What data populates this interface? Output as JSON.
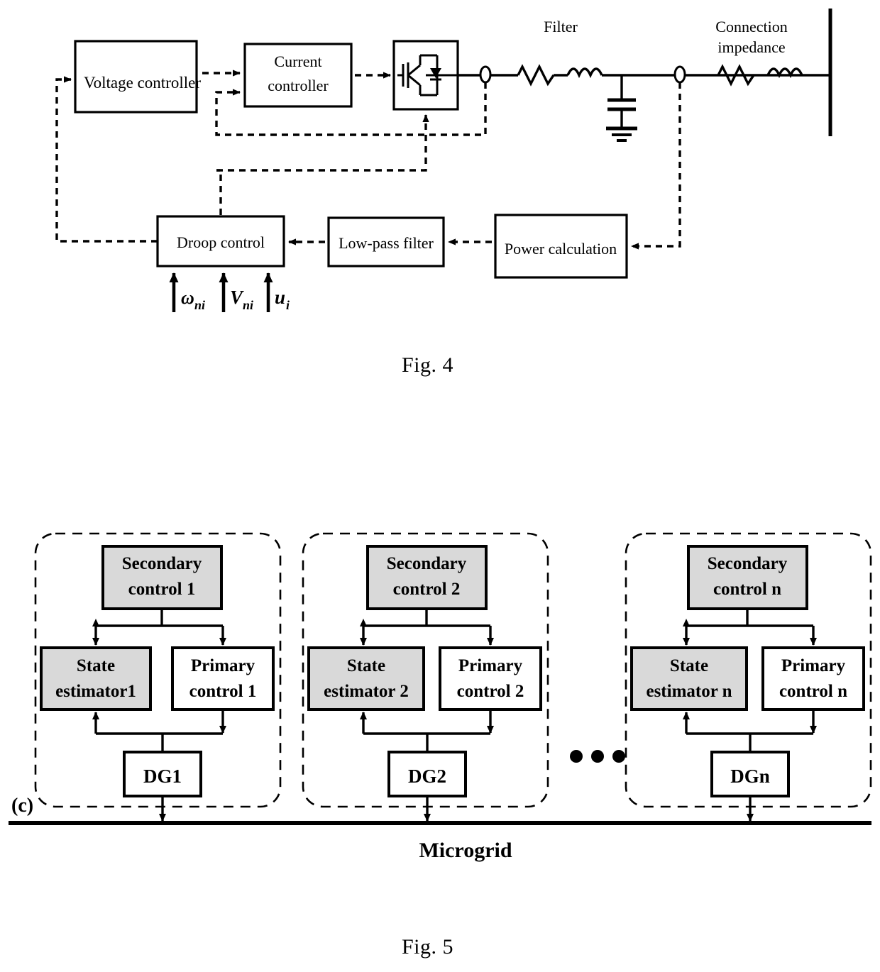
{
  "figure4": {
    "caption": "Fig. 4",
    "blocks": {
      "voltage_controller": "Voltage controller",
      "current_controller_line1": "Current",
      "current_controller_line2": "controller",
      "inverter": "inverter-igbt-symbol",
      "droop_control": "Droop control",
      "low_pass_filter": "Low-pass filter",
      "power_calculation": "Power calculation"
    },
    "labels": {
      "filter": "Filter",
      "connection_impedance_line1": "Connection",
      "connection_impedance_line2": "impedance"
    },
    "droop_inputs": [
      {
        "base": "ω",
        "sub": "ni"
      },
      {
        "base": "V",
        "sub": "ni"
      },
      {
        "base": "u",
        "sub": "i"
      }
    ],
    "circuit_icons": {
      "resistor": "resistor-symbol",
      "inductor": "inductor-symbol",
      "capacitor": "capacitor-symbol",
      "ground": "ground-symbol",
      "measurement_node": "measurement-node-symbol",
      "bus": "bus-bar-symbol"
    }
  },
  "figure5": {
    "caption": "Fig. 5",
    "subfigure_label": "(c)",
    "bus_label": "Microgrid",
    "ellipsis": "• • •",
    "groups": [
      {
        "secondary_line1": "Secondary",
        "secondary_line2": "control 1",
        "estimator_line1": "State",
        "estimator_line2": "estimator1",
        "primary_line1": "Primary",
        "primary_line2": "control 1",
        "dg": "DG1"
      },
      {
        "secondary_line1": "Secondary",
        "secondary_line2": "control 2",
        "estimator_line1": "State",
        "estimator_line2": "estimator 2",
        "primary_line1": "Primary",
        "primary_line2": "control 2",
        "dg": "DG2"
      },
      {
        "secondary_line1": "Secondary",
        "secondary_line2": "control n",
        "estimator_line1": "State",
        "estimator_line2": "estimator n",
        "primary_line1": "Primary",
        "primary_line2": "control n",
        "dg": "DGn"
      }
    ]
  },
  "colors": {
    "ink": "#000000",
    "paper": "#ffffff",
    "shaded_block": "#d9d9d9"
  }
}
